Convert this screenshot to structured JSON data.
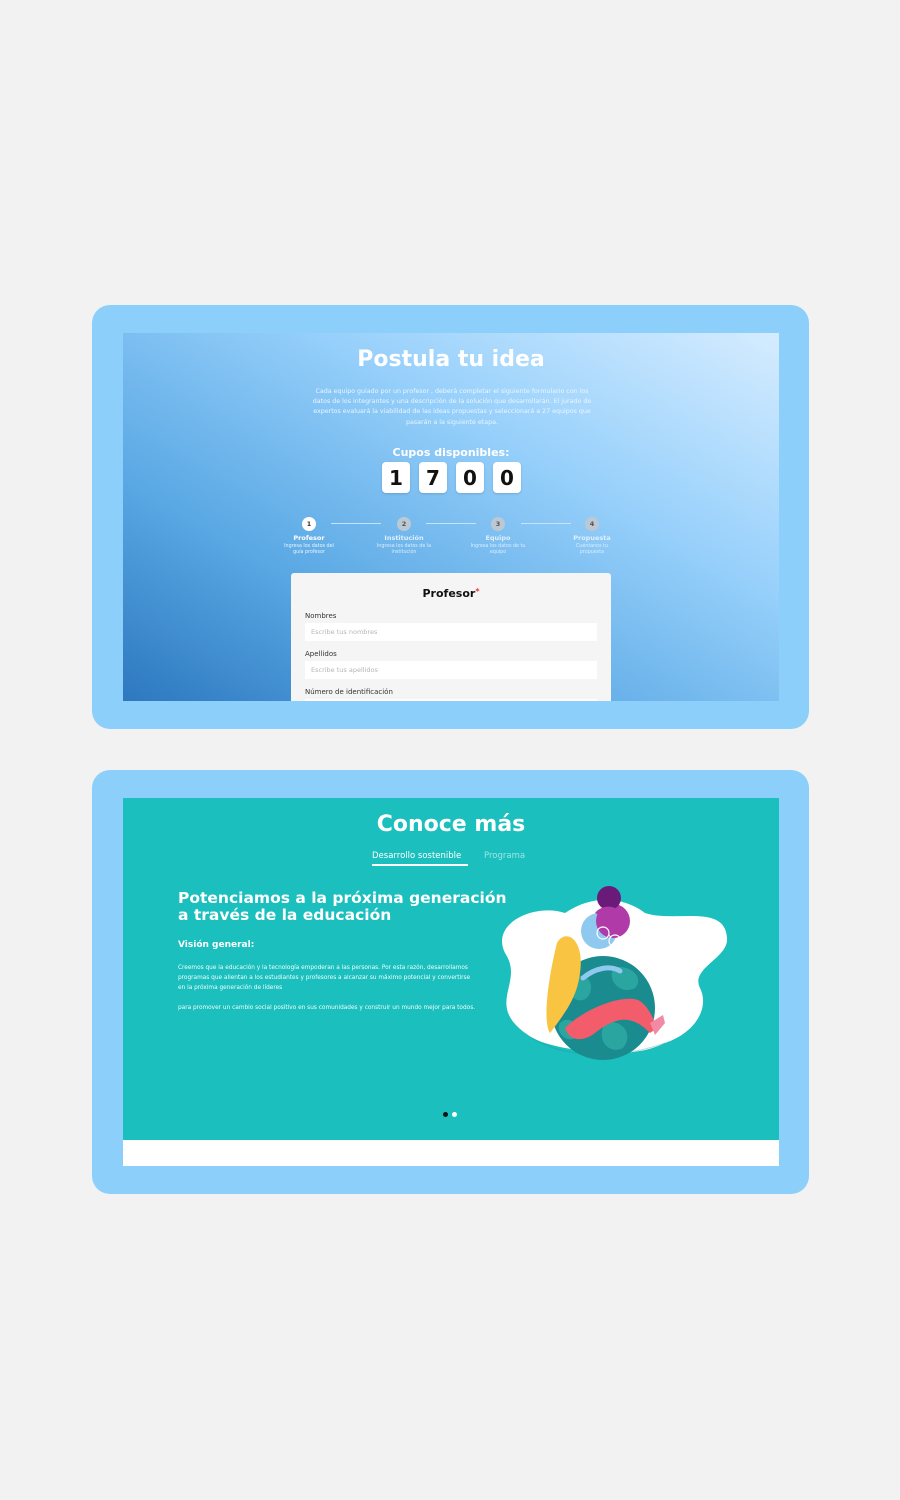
{
  "screen1": {
    "title": "Postula tu idea",
    "description": "Cada equipo guiado por un profesor , deberá completar el siguiente formulario con los datos de los integrantes y una descripción de la solución que desarrollarán. El jurado de expertos evaluará la viabilidad de las ideas propuestas y seleccionará a 27 equipos que pasarán a la siguiente etapa.",
    "cupos_label": "Cupos disponibles:",
    "digits": [
      "1",
      "7",
      "0",
      "0"
    ],
    "steps": [
      {
        "number": "1",
        "name": "Profesor",
        "sub": "Ingresa los datos del guía profesor"
      },
      {
        "number": "2",
        "name": "Institución",
        "sub": "Ingresa los datos de la institución"
      },
      {
        "number": "3",
        "name": "Equipo",
        "sub": "Ingresa los datos de tu equipo"
      },
      {
        "number": "4",
        "name": "Propuesta",
        "sub": "Cuéntanos tu propuesta"
      }
    ],
    "form": {
      "title": "Profesor",
      "required_mark": "*",
      "fields": [
        {
          "label": "Nombres",
          "placeholder": "Escribe tus nombres"
        },
        {
          "label": "Apellidos",
          "placeholder": "Escribe tus apellidos"
        },
        {
          "label": "Número de identificación",
          "placeholder": ""
        }
      ]
    }
  },
  "screen2": {
    "title": "Conoce más",
    "tabs": [
      "Desarrollo sostenible",
      "Programa"
    ],
    "active_tab": "Desarrollo sostenible",
    "headline": "Potenciamos a la próxima generación a través de la educación",
    "subhead": "Visión general:",
    "paragraph1": "Creemos que la educación y la tecnología empoderan a las personas. Por esta razón, desarrollamos programas que alientan a los estudiantes y profesores a alcanzar su máximo potencial y convertirse en la próxima generación de líderes",
    "paragraph2": "para promover un cambio social positivo en sus comunidades y construir un mundo mejor para todos.",
    "carousel_active_index": 0,
    "carousel_count": 2
  },
  "colors": {
    "frame": "#8ccffb",
    "page_bg": "#f2f2f2",
    "teal": "#1bbfbd",
    "accent_red": "#e53935"
  }
}
